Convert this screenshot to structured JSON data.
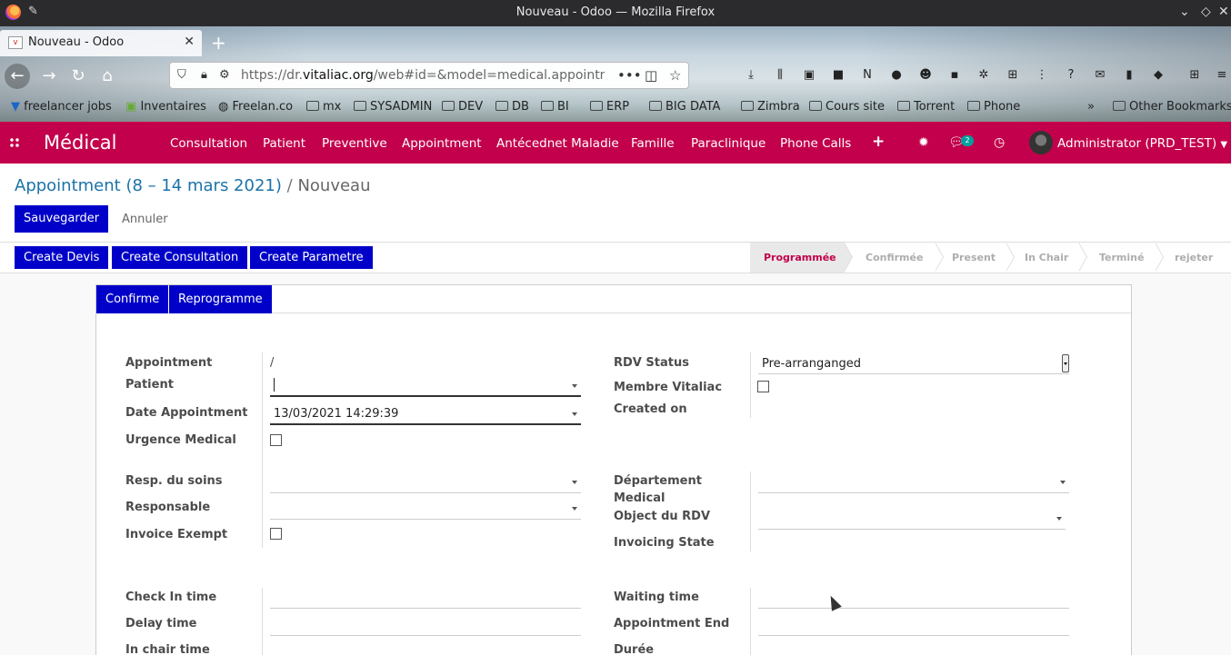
{
  "browser": {
    "window_title": "Nouveau - Odoo — Mozilla Firefox",
    "tab_title": "Nouveau - Odoo",
    "url_prefix": "https://dr.",
    "url_domain": "vitaliac.org",
    "url_suffix": "/web#id=&model=medical.appointment&",
    "bookmarks": [
      "freelancer jobs",
      "Inventaires",
      "Freelan.co",
      "mx",
      "SYSADMIN",
      "DEV",
      "DB",
      "BI",
      "ERP",
      "BIG DATA",
      "Zimbra",
      "Cours site",
      "Torrent",
      "Phone"
    ],
    "other_bookmarks": "Other Bookmarks"
  },
  "odoo": {
    "app_name": "Médical",
    "menu": [
      "Consultation",
      "Patient",
      "Preventive",
      "Appointment",
      "Antécednet Maladie",
      "Famille",
      "Paraclinique",
      "Phone Calls"
    ],
    "chat_count": "2",
    "user": "Administrator (PRD_TEST)",
    "brand_color": "#c3004b",
    "button_color": "#0000c8"
  },
  "control_panel": {
    "breadcrumb_parent": "Appointment (8 – 14 mars 2021)",
    "breadcrumb_sep": "/",
    "breadcrumb_current": "Nouveau",
    "save": "Sauvegarder",
    "discard": "Annuler"
  },
  "header_buttons": [
    "Create Devis",
    "Create Consultation",
    "Create Parametre"
  ],
  "stages": [
    "Programmée",
    "Confirmée",
    "Present",
    "In Chair",
    "Terminé",
    "rejeter"
  ],
  "active_stage": "Programmée",
  "sheet_buttons": [
    "Confirme",
    "Reprogramme"
  ],
  "form": {
    "left1": {
      "appointment_label": "Appointment",
      "appointment_value": "/",
      "patient_label": "Patient",
      "patient_value": "",
      "date_label": "Date Appointment",
      "date_value": "13/03/2021 14:29:39",
      "urgence_label": "Urgence Medical"
    },
    "right1": {
      "rdv_status_label": "RDV Status",
      "rdv_status_value": "Pre-arranganged",
      "membre_label": "Membre Vitaliac",
      "created_label": "Created on"
    },
    "left2": {
      "resp_label": "Resp. du soins",
      "responsable_label": "Responsable",
      "invoice_exempt_label": "Invoice Exempt"
    },
    "right2": {
      "departement_label_1": "Département",
      "departement_label_2": "Medical",
      "object_label": "Object du RDV",
      "invoicing_label": "Invoicing State"
    },
    "left3": {
      "checkin_label": "Check In time",
      "delay_label": "Delay time",
      "inchair_label": "In chair time"
    },
    "right3": {
      "waiting_label": "Waiting time",
      "end_label": "Appointment End",
      "duree_label": "Durée"
    }
  }
}
